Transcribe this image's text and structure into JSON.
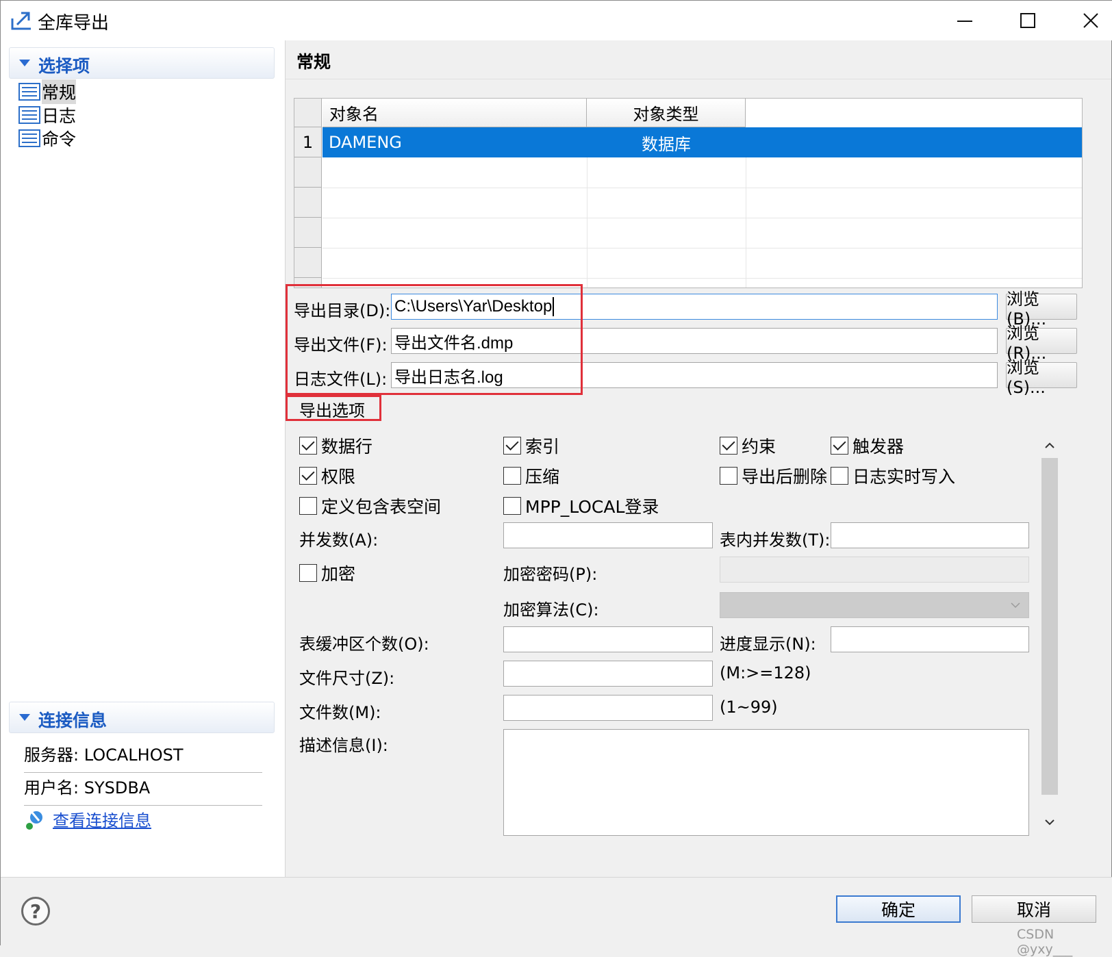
{
  "window": {
    "title": "全库导出",
    "icon": "export-icon",
    "controls": {
      "minimize": "minimize-icon",
      "maximize": "maximize-icon",
      "close": "close-icon"
    }
  },
  "sidebar": {
    "section_title": "选择项",
    "items": [
      {
        "label": "常规",
        "selected": true
      },
      {
        "label": "日志",
        "selected": false
      },
      {
        "label": "命令",
        "selected": false
      }
    ],
    "connection": {
      "section_title": "连接信息",
      "server": "服务器: LOCALHOST",
      "user": "用户名: SYSDBA",
      "link": "查看连接信息"
    }
  },
  "main": {
    "title": "常规",
    "grid": {
      "columns": [
        "对象名",
        "对象类型"
      ],
      "rows": [
        {
          "num": "1",
          "name": "DAMENG",
          "type": "数据库"
        }
      ]
    },
    "paths": {
      "export_dir_label": "导出目录(D):",
      "export_dir_value": "C:\\Users\\Yar\\Desktop",
      "export_dir_browse": "浏览(B)...",
      "export_file_label": "导出文件(F):",
      "export_file_value": "导出文件名.dmp",
      "export_file_browse": "浏览(R)...",
      "log_file_label": "日志文件(L):",
      "log_file_value": "导出日志名.log",
      "log_file_browse": "浏览(S)..."
    },
    "options": {
      "tab_label": "导出选项",
      "checkboxes": {
        "rows": {
          "label": "数据行",
          "checked": true
        },
        "index": {
          "label": "索引",
          "checked": true
        },
        "constraint": {
          "label": "约束",
          "checked": true
        },
        "trigger": {
          "label": "触发器",
          "checked": true
        },
        "grant": {
          "label": "权限",
          "checked": true
        },
        "compress": {
          "label": "压缩",
          "checked": false
        },
        "drop_after": {
          "label": "导出后删除",
          "checked": false
        },
        "log_realtime": {
          "label": "日志实时写入",
          "checked": false
        },
        "tablespace": {
          "label": "定义包含表空间",
          "checked": false
        },
        "mpp_local": {
          "label": "MPP_LOCAL登录",
          "checked": false
        },
        "encrypt": {
          "label": "加密",
          "checked": false
        }
      },
      "parallel_label": "并发数(A):",
      "table_parallel_label": "表内并发数(T):",
      "encrypt_pwd_label": "加密密码(P):",
      "encrypt_algo_label": "加密算法(C):",
      "table_buffer_label": "表缓冲区个数(O):",
      "progress_label": "进度显示(N):",
      "file_size_label": "文件尺寸(Z):",
      "file_size_hint": "(M:>=128)",
      "file_count_label": "文件数(M):",
      "file_count_hint": "(1~99)",
      "description_label": "描述信息(I):"
    }
  },
  "footer": {
    "help_icon": "help-icon",
    "help_glyph": "?",
    "ok": "确定",
    "cancel": "取消",
    "watermark": "CSDN @yxy___"
  },
  "colors": {
    "selection": "#0a78d7",
    "section_title": "#1b5bc2",
    "highlight_box": "#e0303a",
    "ok_border": "#3b7ad0"
  }
}
